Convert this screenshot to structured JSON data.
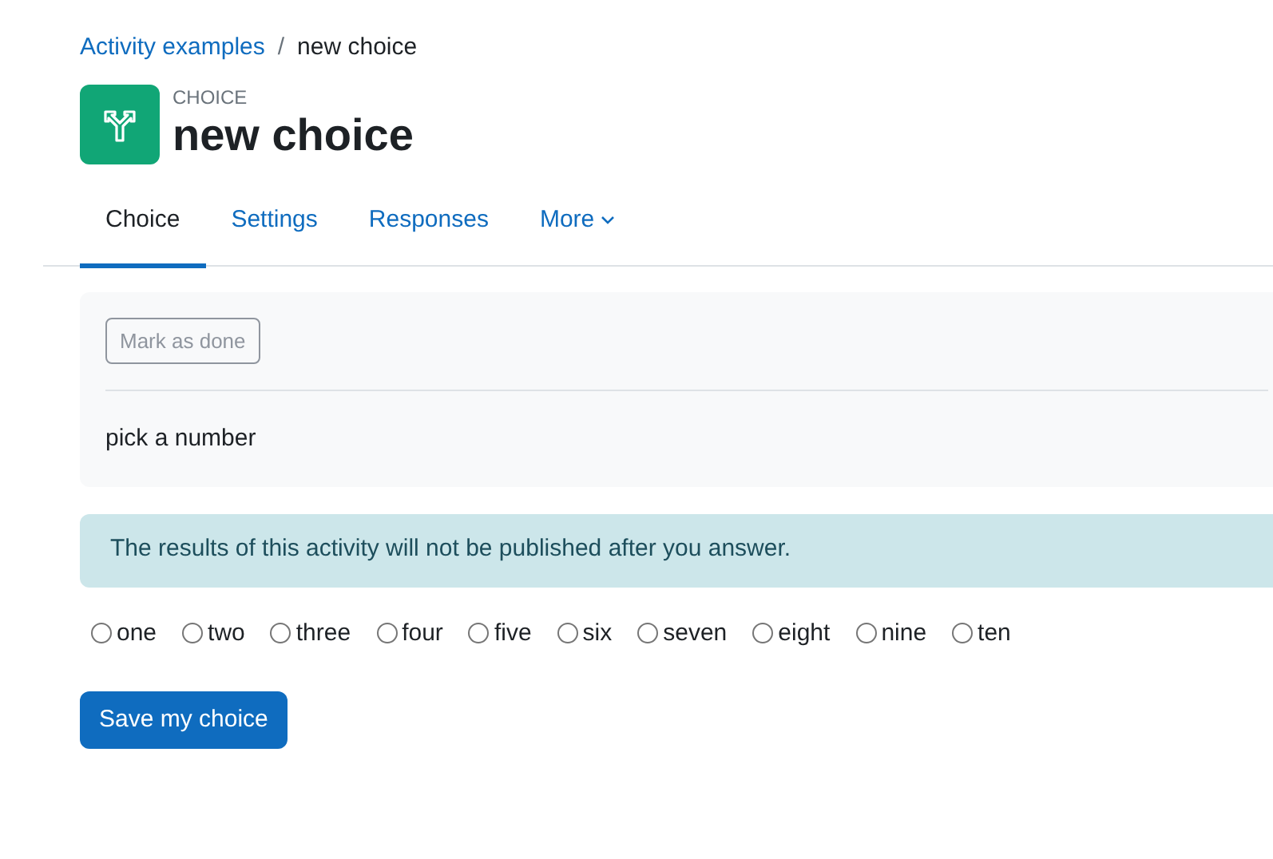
{
  "breadcrumb": [
    {
      "label": "Activity examples",
      "link": true
    },
    {
      "label": "new choice",
      "link": false
    }
  ],
  "breadcrumb_separator": "/",
  "header": {
    "kind_label": "CHOICE",
    "title": "new choice"
  },
  "tabs": [
    {
      "label": "Choice",
      "selected": true
    },
    {
      "label": "Settings",
      "selected": false
    },
    {
      "label": "Responses",
      "selected": false
    },
    {
      "label": "More",
      "selected": false,
      "dropdown": true
    }
  ],
  "mark_done_button": "Mark as done",
  "intro": "pick a number",
  "notice": "The results of this activity will not be published after you answer.",
  "options": [
    {
      "label": "one",
      "selected": false
    },
    {
      "label": "two",
      "selected": false
    },
    {
      "label": "three",
      "selected": false
    },
    {
      "label": "four",
      "selected": false
    },
    {
      "label": "five",
      "selected": false
    },
    {
      "label": "six",
      "selected": false
    },
    {
      "label": "seven",
      "selected": false
    },
    {
      "label": "eight",
      "selected": false
    },
    {
      "label": "nine",
      "selected": false
    },
    {
      "label": "ten",
      "selected": false
    }
  ],
  "save_button": "Save my choice"
}
